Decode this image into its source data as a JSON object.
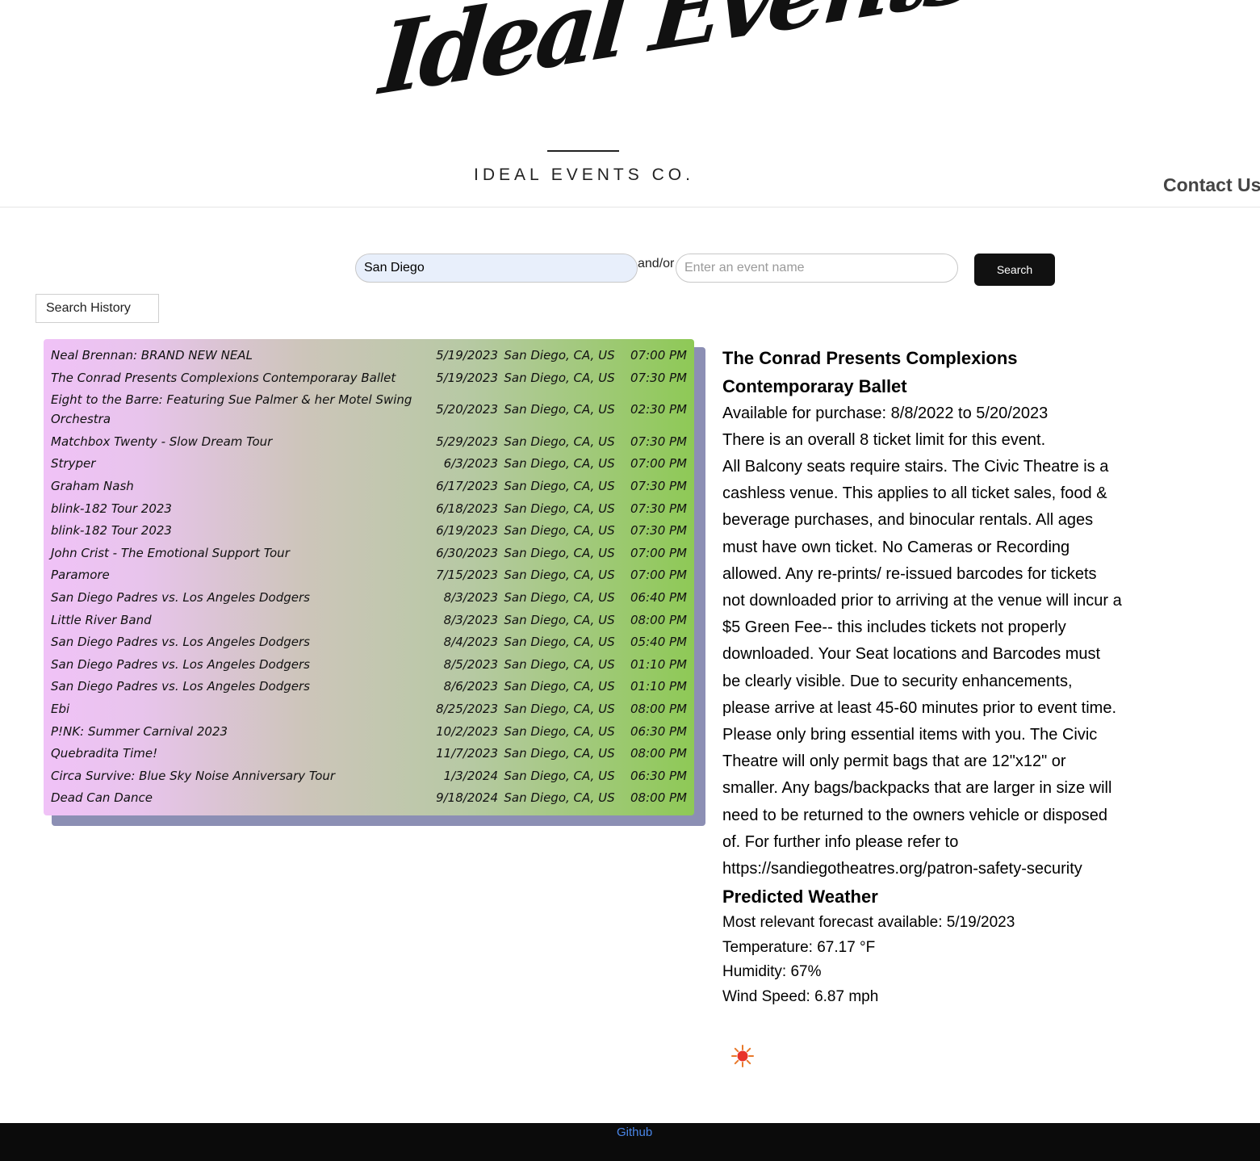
{
  "header": {
    "logo_script": "Ideal Events",
    "logo_subtitle": "IDEAL EVENTS CO.",
    "contact_label": "Contact Us"
  },
  "search": {
    "city_value": "San Diego",
    "separator": "and/or",
    "event_placeholder": "Enter an event name",
    "search_label": "Search",
    "history_label": "Search History"
  },
  "events": [
    {
      "name": "Neal Brennan: BRAND NEW NEAL",
      "date": "5/19/2023",
      "city": "San Diego, CA, US",
      "time": "07:00 PM"
    },
    {
      "name": "The Conrad Presents Complexions Contemporaray Ballet",
      "date": "5/19/2023",
      "city": "San Diego, CA, US",
      "time": "07:30 PM"
    },
    {
      "name": "Eight to the Barre: Featuring Sue Palmer & her Motel Swing Orchestra",
      "date": "5/20/2023",
      "city": "San Diego, CA, US",
      "time": "02:30 PM"
    },
    {
      "name": "Matchbox Twenty - Slow Dream Tour",
      "date": "5/29/2023",
      "city": "San Diego, CA, US",
      "time": "07:30 PM"
    },
    {
      "name": "Stryper",
      "date": "6/3/2023",
      "city": "San Diego, CA, US",
      "time": "07:00 PM"
    },
    {
      "name": "Graham Nash",
      "date": "6/17/2023",
      "city": "San Diego, CA, US",
      "time": "07:30 PM"
    },
    {
      "name": "blink-182 Tour 2023",
      "date": "6/18/2023",
      "city": "San Diego, CA, US",
      "time": "07:30 PM"
    },
    {
      "name": "blink-182 Tour 2023",
      "date": "6/19/2023",
      "city": "San Diego, CA, US",
      "time": "07:30 PM"
    },
    {
      "name": "John Crist - The Emotional Support Tour",
      "date": "6/30/2023",
      "city": "San Diego, CA, US",
      "time": "07:00 PM"
    },
    {
      "name": "Paramore",
      "date": "7/15/2023",
      "city": "San Diego, CA, US",
      "time": "07:00 PM"
    },
    {
      "name": "San Diego Padres vs. Los Angeles Dodgers",
      "date": "8/3/2023",
      "city": "San Diego, CA, US",
      "time": "06:40 PM"
    },
    {
      "name": "Little River Band",
      "date": "8/3/2023",
      "city": "San Diego, CA, US",
      "time": "08:00 PM"
    },
    {
      "name": "San Diego Padres vs. Los Angeles Dodgers",
      "date": "8/4/2023",
      "city": "San Diego, CA, US",
      "time": "05:40 PM"
    },
    {
      "name": "San Diego Padres vs. Los Angeles Dodgers",
      "date": "8/5/2023",
      "city": "San Diego, CA, US",
      "time": "01:10 PM"
    },
    {
      "name": "San Diego Padres vs. Los Angeles Dodgers",
      "date": "8/6/2023",
      "city": "San Diego, CA, US",
      "time": "01:10 PM"
    },
    {
      "name": "Ebi",
      "date": "8/25/2023",
      "city": "San Diego, CA, US",
      "time": "08:00 PM"
    },
    {
      "name": "P!NK: Summer Carnival 2023",
      "date": "10/2/2023",
      "city": "San Diego, CA, US",
      "time": "06:30 PM"
    },
    {
      "name": "Quebradita Time!",
      "date": "11/7/2023",
      "city": "San Diego, CA, US",
      "time": "08:00 PM"
    },
    {
      "name": "Circa Survive: Blue Sky Noise Anniversary Tour",
      "date": "1/3/2024",
      "city": "San Diego, CA, US",
      "time": "06:30 PM"
    },
    {
      "name": "Dead Can Dance",
      "date": "9/18/2024",
      "city": "San Diego, CA, US",
      "time": "08:00 PM"
    }
  ],
  "detail": {
    "title": "The Conrad Presents Complexions Contemporaray Ballet",
    "availability": "Available for purchase: 8/8/2022 to 5/20/2023",
    "ticket_limit": "There is an overall 8 ticket limit for this event.",
    "info": "All Balcony seats require stairs. The Civic Theatre is a cashless venue. This applies to all ticket sales, food & beverage purchases, and binocular rentals. All ages must have own ticket. No Cameras or Recording allowed. Any re-prints/ re-issued barcodes for tickets not downloaded prior to arriving at the venue will incur a $5 Green Fee-- this includes tickets not properly downloaded. Your Seat locations and Barcodes must be clearly visible. Due to security enhancements, please arrive at least 45-60 minutes prior to event time. Please only bring essential items with you. The Civic Theatre will only permit bags that are 12\"x12\" or smaller. Any bags/backpacks that are larger in size will need to be returned to the owners vehicle or disposed of. For further info please refer to https://sandiegotheatres.org/patron-safety-security"
  },
  "weather": {
    "title": "Predicted Weather",
    "forecast_date": "Most relevant forecast available: 5/19/2023",
    "temperature": "Temperature: 67.17 °F",
    "humidity": "Humidity: 67%",
    "wind": "Wind Speed: 6.87 mph",
    "icon": "sun-icon"
  },
  "footer": {
    "github_label": "Github"
  },
  "colors": {
    "gradient_start": "#f0c2f7",
    "gradient_end": "#8ec956",
    "shadow": "#8c8fb4",
    "search_button": "#111111",
    "footer_bg": "#0b0b0b",
    "link": "#4a86e8"
  }
}
